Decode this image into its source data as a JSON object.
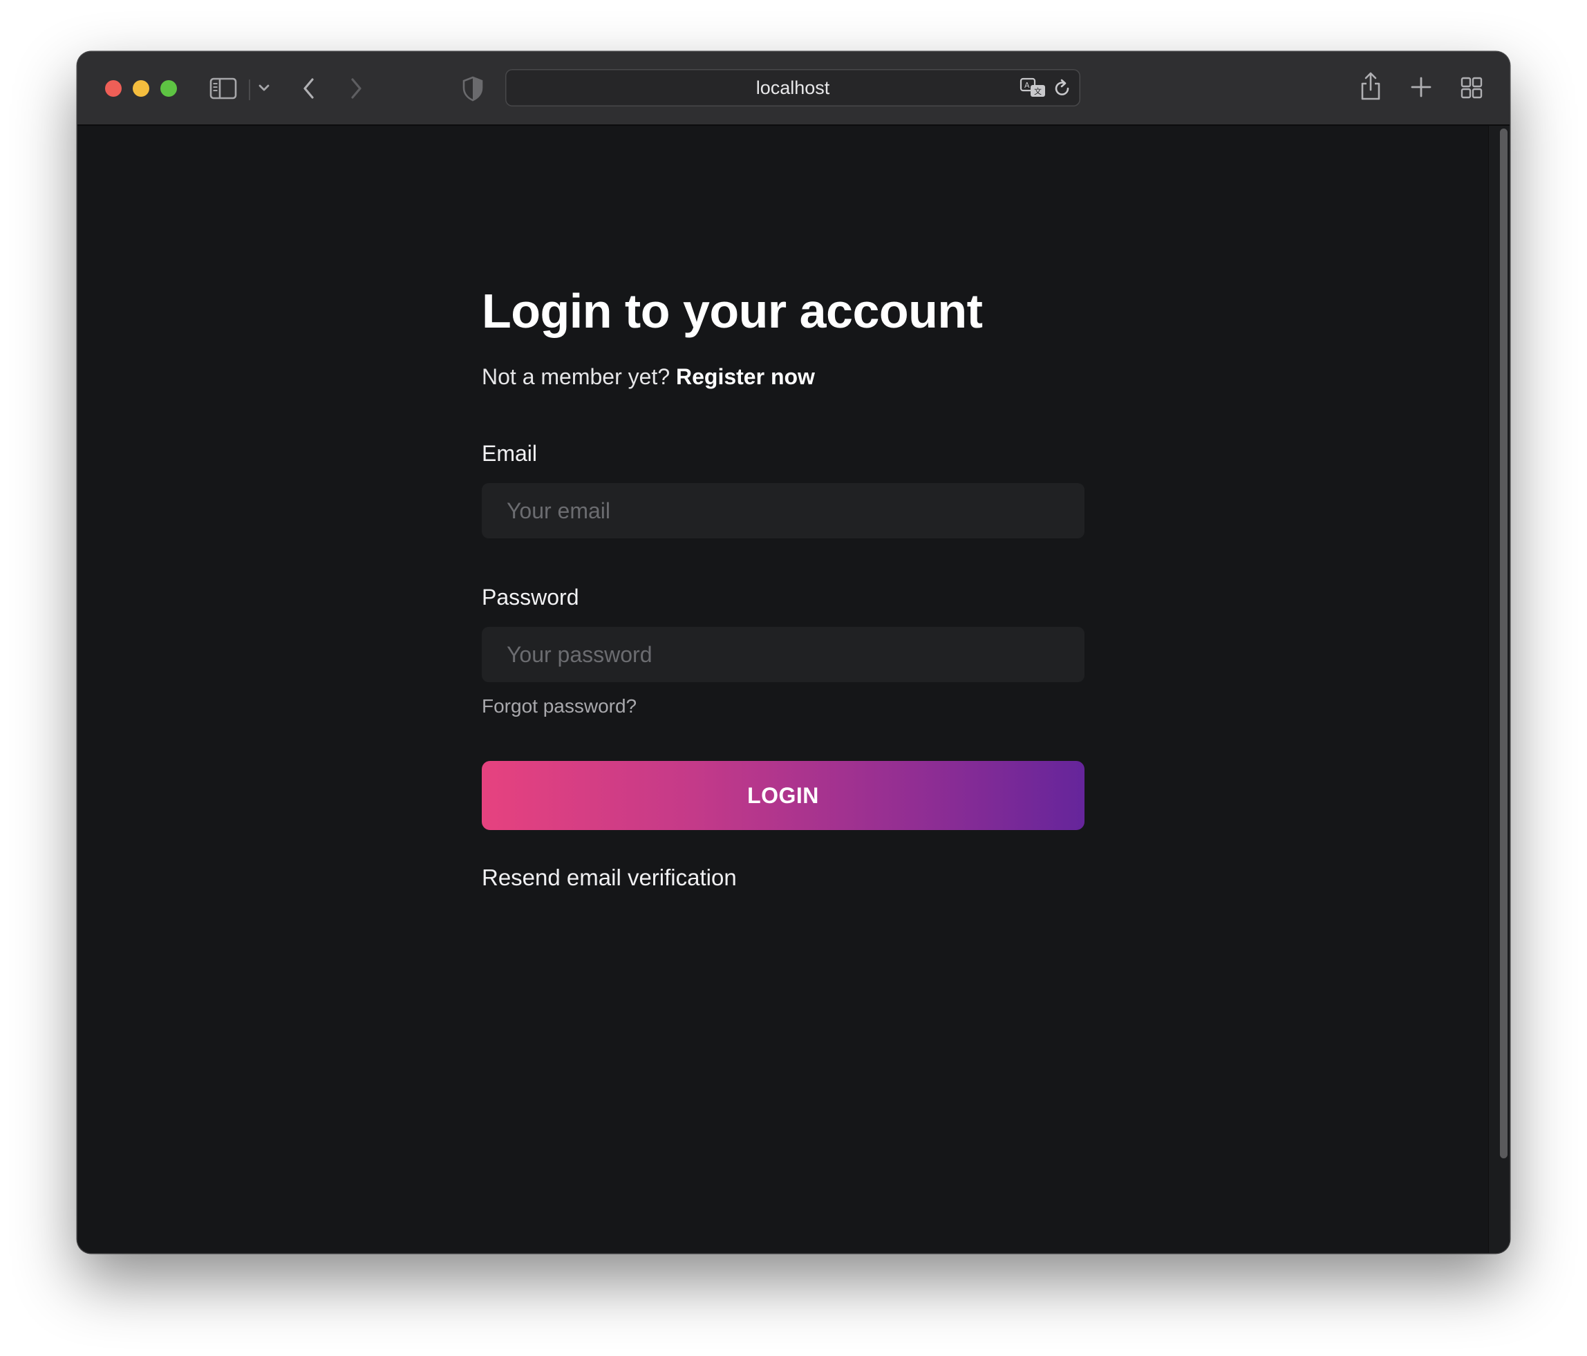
{
  "browser": {
    "address": "localhost",
    "icons": {
      "sidebar": "sidebar-icon",
      "sidebar_menu": "chevron-down-icon",
      "back": "chevron-left-icon",
      "forward": "chevron-right-icon",
      "privacy": "shield-icon",
      "translate": "translate-icon",
      "reload": "reload-icon",
      "share": "share-icon",
      "new_tab": "plus-icon",
      "tab_overview": "grid-icon"
    }
  },
  "page": {
    "title": "Login to your account",
    "subtitle_prefix": "Not a member yet?",
    "register_link": "Register now",
    "email": {
      "label": "Email",
      "placeholder": "Your email",
      "value": ""
    },
    "password": {
      "label": "Password",
      "placeholder": "Your password",
      "value": ""
    },
    "forgot_link": "Forgot password?",
    "login_button": "LOGIN",
    "resend_link": "Resend email verification"
  },
  "colors": {
    "background": "#151618",
    "input_background": "#202123",
    "button_gradient_start": "#e6427f",
    "button_gradient_end": "#65259b",
    "text_primary": "#ffffff",
    "text_muted": "#a9a9ad"
  }
}
